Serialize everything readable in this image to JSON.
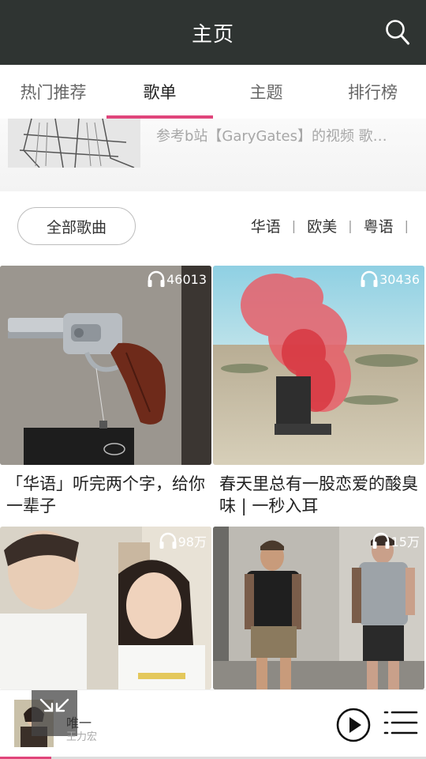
{
  "header": {
    "title": "主页",
    "search_icon": "search-icon"
  },
  "tabs": [
    {
      "label": "热门推荐",
      "active": false
    },
    {
      "label": "歌单",
      "active": true
    },
    {
      "label": "主题",
      "active": false
    },
    {
      "label": "排行榜",
      "active": false
    }
  ],
  "banner": {
    "text": "参考b站【GaryGates】的视频 歌…"
  },
  "filter": {
    "all_label": "全部歌曲",
    "categories": [
      "华语",
      "欧美",
      "粤语"
    ],
    "separator": "|"
  },
  "playlists": [
    {
      "count": "46013",
      "title": "「华语」听完两个字，给你一辈子"
    },
    {
      "count": "30436",
      "title": "春天里总有一股恋爱的酸臭味 | 一秒入耳"
    },
    {
      "count": "98万",
      "title": ""
    },
    {
      "count": "15万",
      "title": ""
    }
  ],
  "player": {
    "song": "唯一",
    "artist": "王力宏",
    "progress": 0.12
  },
  "colors": {
    "header_bg": "#2f3432",
    "accent": "#e0457b"
  }
}
